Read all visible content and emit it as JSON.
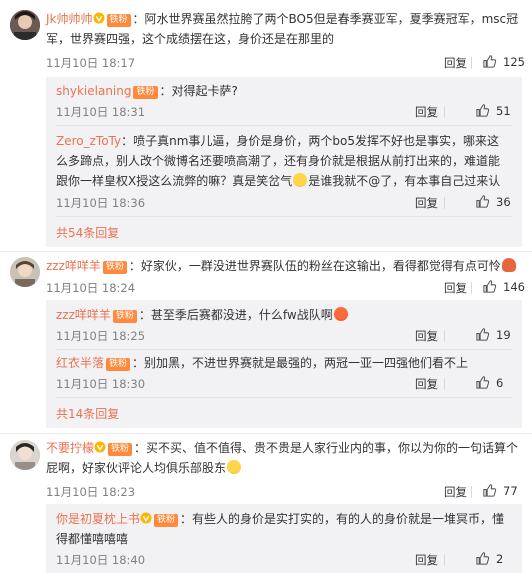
{
  "comments": [
    {
      "user": "Jk帅帅帅",
      "badge": "铁粉",
      "text": "：阿水世界赛虽然拉胯了两个BO5但是春季赛亚军，夏季赛冠军，msc冠军，世界赛四强，这个成绩摆在这，身价还是在那里的",
      "time": "11月10日 18:17",
      "reply_label": "回复",
      "likes": "125",
      "replies": [
        {
          "user": "shykielaning",
          "badge": "铁粉",
          "text": "：对得起卡萨?",
          "time": "11月10日 18:31",
          "reply_label": "回复",
          "likes": "51"
        },
        {
          "user": "Zero_zToTy",
          "text": "：喷子真nm事儿逼，身价是身价，两个bo5发挥不好也是事实，哪来这么多蹄点，别人改个微博名还要喷高潮了，还有身价就是根据从前打出来的，难道能跟你一样皇权X授这么流弊的嘛？真是笑岔气",
          "text_end": "是谁我就不@了，有本事自己过来认",
          "time": "11月10日 18:36",
          "reply_label": "回复",
          "likes": "36"
        }
      ],
      "more_label": "共54条回复"
    },
    {
      "user": "zzz咩咩羊",
      "badge": "铁粉",
      "text": "：好家伙，一群没进世界赛队伍的粉丝在这输出，看得都觉得有点可怜",
      "time": "11月10日 18:24",
      "reply_label": "回复",
      "likes": "146",
      "replies": [
        {
          "user": "zzz咩咩羊",
          "badge": "铁粉",
          "text": "：甚至季后赛都没进，什么fw战队啊",
          "time": "11月10日 18:25",
          "reply_label": "回复",
          "likes": "19"
        },
        {
          "user": "红衣半落",
          "badge": "铁粉",
          "text": "：别加黑，不进世界赛就是最强的，两冠一亚一四强他们看不上",
          "time": "11月10日 18:30",
          "reply_label": "回复",
          "likes": "6"
        }
      ],
      "more_label": "共14条回复"
    },
    {
      "user": "不要拧檬",
      "badge": "铁粉",
      "text": "：买不买、值不值得、贵不贵是人家行业内的事，你以为你的一句话算个屁啊，好家伙评论人均俱乐部股东",
      "time": "11月10日 18:23",
      "reply_label": "回复",
      "likes": "77",
      "replies": [
        {
          "user": "你是初夏枕上书",
          "badge": "铁粉",
          "text": "：有些人的身价是实打实的，有的人的身价就是一堆冥币，懂得都懂嘻嘻嘻",
          "time": "11月10日 18:40",
          "reply_label": "回复",
          "likes": "2"
        }
      ]
    }
  ]
}
